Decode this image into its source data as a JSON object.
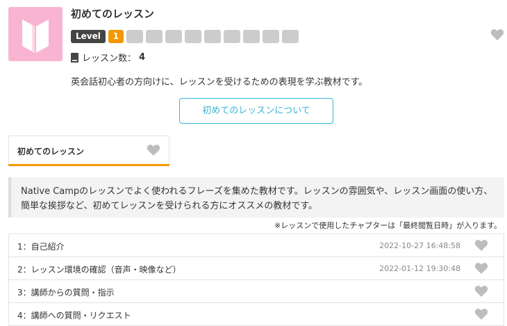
{
  "course": {
    "title": "初めてのレッスン",
    "level_label": "Level",
    "level_value": "1",
    "lesson_count_label": "レッスン数：",
    "lesson_count": "4",
    "description": "英会話初心者の方向けに、レッスンを受けるための表現を学ぶ教材です。",
    "about_button": "初めてのレッスンについて",
    "level_total_boxes": 9
  },
  "tab": {
    "label": "初めてのレッスン"
  },
  "intro": {
    "text": "Native Campのレッスンでよく使われるフレーズを集めた教材です。レッスンの雰囲気や、レッスン画面の使い方、簡単な挨拶など、初めてレッスンを受けられる方にオススメの教材です。"
  },
  "note": "※レッスンで使用したチャプターは「最終閲覧日時」が入ります。",
  "chapters": [
    {
      "label": "1：自己紹介",
      "date": "2022-10-27 16:48:58"
    },
    {
      "label": "2：レッスン環境の確認（音声・映像など）",
      "date": "2022-01-12 19:30:48"
    },
    {
      "label": "3：講師からの質問・指示",
      "date": ""
    },
    {
      "label": "4：講師への質問・リクエスト",
      "date": ""
    }
  ],
  "colors": {
    "accent_orange": "#f39800",
    "accent_blue": "#36b6d6",
    "thumb_pink": "#f9b4d2",
    "heart_gray": "#bdbdbd"
  }
}
